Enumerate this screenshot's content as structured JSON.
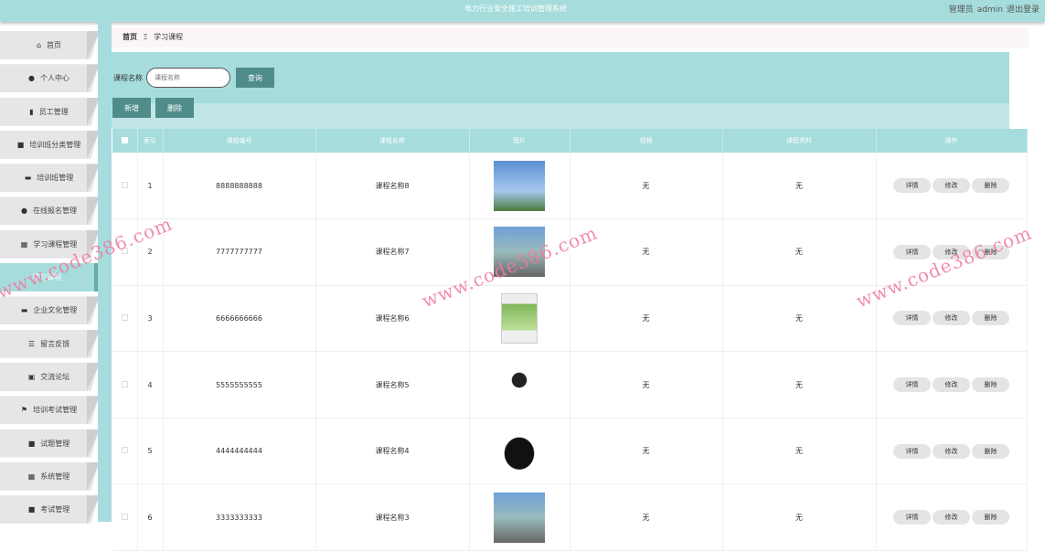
{
  "header": {
    "title": "电力行业安全施工培训管理系统",
    "role": "管理员",
    "username": "admin",
    "logout": "退出登录"
  },
  "sidebar": {
    "items": [
      {
        "icon": "home-icon",
        "glyph": "⌂",
        "label": "首页"
      },
      {
        "icon": "user-icon",
        "glyph": "●",
        "label": "个人中心"
      },
      {
        "icon": "bar-chart-icon",
        "glyph": "▮",
        "label": "员工管理"
      },
      {
        "icon": "grid-icon",
        "glyph": "■",
        "label": "培训班分类管理"
      },
      {
        "icon": "message-icon",
        "glyph": "▬",
        "label": "培训班管理"
      },
      {
        "icon": "user-icon",
        "glyph": "●",
        "label": "在线报名管理"
      },
      {
        "icon": "grid-icon",
        "glyph": "▦",
        "label": "学习课程管理"
      },
      {
        "icon": "",
        "glyph": "",
        "label": "学习课程"
      },
      {
        "icon": "monitor-icon",
        "glyph": "▬",
        "label": "企业文化管理"
      },
      {
        "icon": "list-icon",
        "glyph": "☰",
        "label": "留言反馈"
      },
      {
        "icon": "clipboard-icon",
        "glyph": "▣",
        "label": "交流论坛"
      },
      {
        "icon": "flag-icon",
        "glyph": "⚑",
        "label": "培训考试管理"
      },
      {
        "icon": "grid-icon",
        "glyph": "■",
        "label": "试题管理"
      },
      {
        "icon": "grid-icon",
        "glyph": "▦",
        "label": "系统管理"
      },
      {
        "icon": "grid-icon",
        "glyph": "■",
        "label": "考试管理"
      }
    ]
  },
  "breadcrumb": {
    "home": "首页",
    "sep": "Ξ",
    "current": "学习课程"
  },
  "search": {
    "label": "课程名称",
    "placeholder": "课程名称",
    "button": "查询"
  },
  "actions": {
    "add": "新增",
    "delete": "删除"
  },
  "table": {
    "headers": [
      "索引",
      "课程编号",
      "课程名称",
      "图片",
      "视频",
      "课程资料",
      "操作"
    ],
    "rows": [
      {
        "index": "1",
        "code": "8888888888",
        "name": "课程名称8",
        "video": "无",
        "material": "无"
      },
      {
        "index": "2",
        "code": "7777777777",
        "name": "课程名称7",
        "video": "无",
        "material": "无"
      },
      {
        "index": "3",
        "code": "6666666666",
        "name": "课程名称6",
        "video": "无",
        "material": "无"
      },
      {
        "index": "4",
        "code": "5555555555",
        "name": "课程名称5",
        "video": "无",
        "material": "无"
      },
      {
        "index": "5",
        "code": "4444444444",
        "name": "课程名称4",
        "video": "无",
        "material": "无"
      },
      {
        "index": "6",
        "code": "3333333333",
        "name": "课程名称3",
        "video": "无",
        "material": "无"
      }
    ],
    "ops": {
      "detail": "详情",
      "edit": "修改",
      "delete": "删除"
    }
  },
  "watermark": "www.code386.com",
  "colors": {
    "accent": "#a6dcdc",
    "button": "#4f8d8b"
  }
}
